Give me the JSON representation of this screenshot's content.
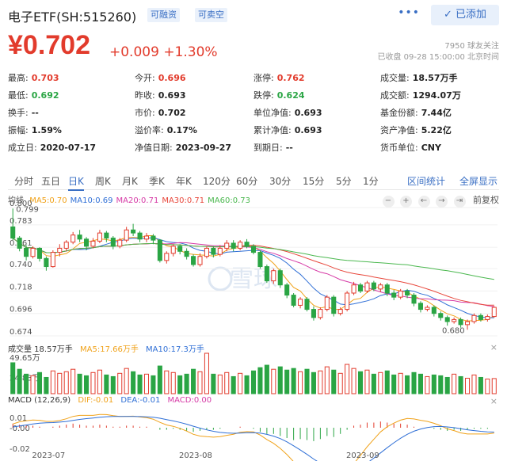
{
  "header": {
    "title": "电子ETF(SH:515260)",
    "tags": [
      "可融资",
      "可卖空"
    ],
    "more": "•••",
    "follow_label": "✓ 已添加"
  },
  "price": {
    "current": "¥0.702",
    "change": "+0.009 +1.30%",
    "followers": "7950 球友关注",
    "status": "已收盘 09-28 15:00:00 北京时间"
  },
  "quote": [
    [
      {
        "label": "最高:",
        "value": "0.703",
        "tone": "up"
      },
      {
        "label": "今开:",
        "value": "0.696",
        "tone": "up"
      },
      {
        "label": "涨停:",
        "value": "0.762",
        "tone": "up"
      },
      {
        "label": "成交量:",
        "value": "18.57万手",
        "tone": ""
      }
    ],
    [
      {
        "label": "最低:",
        "value": "0.692",
        "tone": "down"
      },
      {
        "label": "昨收:",
        "value": "0.693",
        "tone": ""
      },
      {
        "label": "跌停:",
        "value": "0.624",
        "tone": "down"
      },
      {
        "label": "成交额:",
        "value": "1294.07万",
        "tone": ""
      }
    ],
    [
      {
        "label": "换手:",
        "value": "--",
        "tone": ""
      },
      {
        "label": "市价:",
        "value": "0.702",
        "tone": ""
      },
      {
        "label": "单位净值:",
        "value": "0.693",
        "tone": ""
      },
      {
        "label": "基金份额:",
        "value": "7.44亿",
        "tone": ""
      }
    ],
    [
      {
        "label": "振幅:",
        "value": "1.59%",
        "tone": ""
      },
      {
        "label": "溢价率:",
        "value": "0.17%",
        "tone": ""
      },
      {
        "label": "累计净值:",
        "value": "0.693",
        "tone": ""
      },
      {
        "label": "资产净值:",
        "value": "5.22亿",
        "tone": ""
      }
    ],
    [
      {
        "label": "成立日:",
        "value": "2020-07-17",
        "tone": ""
      },
      {
        "label": "净值日期:",
        "value": "2023-09-27",
        "tone": ""
      },
      {
        "label": "到期日:",
        "value": "--",
        "tone": ""
      },
      {
        "label": "货币单位:",
        "value": "CNY",
        "tone": ""
      }
    ]
  ],
  "tabs": {
    "items": [
      "分时",
      "五日",
      "日K",
      "周K",
      "月K",
      "季K",
      "年K",
      "120分",
      "60分",
      "30分",
      "15分",
      "5分",
      "1分"
    ],
    "active": "日K",
    "links": [
      "区间统计",
      "全屏显示"
    ]
  },
  "ma_legend": {
    "label": "均线",
    "items": [
      {
        "text": "MA5:0.70",
        "color": "#f0a21a"
      },
      {
        "text": "MA10:0.69",
        "color": "#2f6fd6"
      },
      {
        "text": "MA20:0.71",
        "color": "#d63aa6"
      },
      {
        "text": "MA30:0.71",
        "color": "#e8483c"
      },
      {
        "text": "MA60:0.73",
        "color": "#4bb84f"
      }
    ]
  },
  "tools": {
    "buttons": [
      "−",
      "+",
      "←",
      "→",
      "⇥"
    ],
    "adjust": "前复权"
  },
  "price_axis": [
    "0.800",
    "0.783",
    "0.761",
    "0.740",
    "0.718",
    "0.696",
    "0.674"
  ],
  "price_labels": {
    "high": "0.799",
    "low": "0.680"
  },
  "volume_legend": {
    "label": "成交量 18.57万手",
    "ma5": "MA5:17.66万手",
    "ma10": "MA10:17.3万手"
  },
  "volume_axis": [
    "49.65万",
    "24.83万"
  ],
  "macd_legend": {
    "label": "MACD (12,26,9)",
    "dif": "DIF:-0.01",
    "dea": "DEA:-0.01",
    "macd": "MACD:0.00"
  },
  "macd_axis": [
    "0.01",
    "-0.00",
    "-0.02"
  ],
  "x_axis": [
    "2023-07",
    "2023-08",
    "2023-09"
  ],
  "watermark": "雪球",
  "colors": {
    "up": "#e23b2c",
    "down": "#2aa544",
    "accent": "#3a6fc4"
  },
  "chart_data": {
    "type": "candlestick",
    "ylim": [
      0.674,
      0.8
    ],
    "candles": [
      [
        0.781,
        0.77,
        0.799,
        0.768
      ],
      [
        0.77,
        0.76,
        0.772,
        0.757
      ],
      [
        0.76,
        0.752,
        0.763,
        0.748
      ],
      [
        0.752,
        0.76,
        0.762,
        0.75
      ],
      [
        0.76,
        0.75,
        0.761,
        0.747
      ],
      [
        0.75,
        0.742,
        0.752,
        0.738
      ],
      [
        0.742,
        0.756,
        0.758,
        0.741
      ],
      [
        0.756,
        0.76,
        0.764,
        0.752
      ],
      [
        0.76,
        0.766,
        0.768,
        0.757
      ],
      [
        0.766,
        0.773,
        0.776,
        0.764
      ],
      [
        0.773,
        0.769,
        0.778,
        0.766
      ],
      [
        0.769,
        0.762,
        0.771,
        0.758
      ],
      [
        0.762,
        0.767,
        0.77,
        0.76
      ],
      [
        0.767,
        0.775,
        0.778,
        0.765
      ],
      [
        0.775,
        0.77,
        0.777,
        0.766
      ],
      [
        0.77,
        0.762,
        0.772,
        0.759
      ],
      [
        0.762,
        0.768,
        0.77,
        0.76
      ],
      [
        0.768,
        0.778,
        0.781,
        0.766
      ],
      [
        0.778,
        0.775,
        0.784,
        0.772
      ],
      [
        0.775,
        0.769,
        0.777,
        0.766
      ],
      [
        0.769,
        0.772,
        0.775,
        0.766
      ],
      [
        0.772,
        0.768,
        0.774,
        0.764
      ],
      [
        0.768,
        0.748,
        0.769,
        0.746
      ],
      [
        0.748,
        0.755,
        0.757,
        0.745
      ],
      [
        0.755,
        0.762,
        0.764,
        0.752
      ],
      [
        0.762,
        0.757,
        0.764,
        0.754
      ],
      [
        0.757,
        0.752,
        0.76,
        0.749
      ],
      [
        0.752,
        0.744,
        0.754,
        0.742
      ],
      [
        0.744,
        0.752,
        0.755,
        0.742
      ],
      [
        0.752,
        0.76,
        0.762,
        0.75
      ],
      [
        0.76,
        0.754,
        0.762,
        0.751
      ],
      [
        0.754,
        0.76,
        0.763,
        0.752
      ],
      [
        0.76,
        0.765,
        0.768,
        0.757
      ],
      [
        0.765,
        0.76,
        0.768,
        0.757
      ],
      [
        0.76,
        0.766,
        0.768,
        0.758
      ],
      [
        0.766,
        0.762,
        0.769,
        0.76
      ],
      [
        0.762,
        0.756,
        0.764,
        0.754
      ],
      [
        0.756,
        0.742,
        0.758,
        0.74
      ],
      [
        0.742,
        0.728,
        0.744,
        0.726
      ],
      [
        0.728,
        0.738,
        0.74,
        0.725
      ],
      [
        0.738,
        0.724,
        0.74,
        0.721
      ],
      [
        0.724,
        0.714,
        0.726,
        0.711
      ],
      [
        0.714,
        0.704,
        0.716,
        0.702
      ],
      [
        0.704,
        0.71,
        0.712,
        0.701
      ],
      [
        0.71,
        0.7,
        0.712,
        0.698
      ],
      [
        0.7,
        0.692,
        0.703,
        0.689
      ],
      [
        0.692,
        0.7,
        0.702,
        0.69
      ],
      [
        0.7,
        0.712,
        0.714,
        0.698
      ],
      [
        0.712,
        0.696,
        0.714,
        0.693
      ],
      [
        0.696,
        0.7,
        0.702,
        0.694
      ],
      [
        0.7,
        0.716,
        0.718,
        0.698
      ],
      [
        0.716,
        0.724,
        0.727,
        0.714
      ],
      [
        0.724,
        0.718,
        0.726,
        0.716
      ],
      [
        0.718,
        0.726,
        0.728,
        0.716
      ],
      [
        0.726,
        0.72,
        0.728,
        0.718
      ],
      [
        0.72,
        0.724,
        0.726,
        0.717
      ],
      [
        0.724,
        0.716,
        0.726,
        0.713
      ],
      [
        0.716,
        0.712,
        0.719,
        0.709
      ],
      [
        0.712,
        0.718,
        0.72,
        0.71
      ],
      [
        0.718,
        0.714,
        0.72,
        0.711
      ],
      [
        0.714,
        0.706,
        0.716,
        0.703
      ],
      [
        0.706,
        0.7,
        0.708,
        0.697
      ],
      [
        0.7,
        0.702,
        0.704,
        0.698
      ],
      [
        0.702,
        0.696,
        0.704,
        0.693
      ],
      [
        0.696,
        0.692,
        0.698,
        0.689
      ],
      [
        0.692,
        0.688,
        0.694,
        0.684
      ],
      [
        0.688,
        0.69,
        0.692,
        0.686
      ],
      [
        0.69,
        0.685,
        0.692,
        0.682
      ],
      [
        0.685,
        0.688,
        0.69,
        0.68
      ],
      [
        0.688,
        0.694,
        0.696,
        0.686
      ],
      [
        0.694,
        0.69,
        0.696,
        0.688
      ],
      [
        0.69,
        0.693,
        0.695,
        0.688
      ],
      [
        0.693,
        0.702,
        0.703,
        0.692
      ]
    ],
    "volume": [
      38,
      30,
      24,
      22,
      26,
      20,
      28,
      25,
      27,
      30,
      24,
      22,
      26,
      29,
      23,
      21,
      25,
      31,
      27,
      23,
      24,
      22,
      34,
      28,
      26,
      22,
      24,
      30,
      27,
      49.65,
      24,
      23,
      26,
      21,
      25,
      22,
      28,
      32,
      35,
      30,
      33,
      29,
      31,
      27,
      30,
      26,
      28,
      33,
      29,
      25,
      36,
      31,
      27,
      29,
      24,
      26,
      28,
      23,
      25,
      22,
      26,
      24,
      21,
      23,
      22,
      20,
      24,
      21,
      19,
      23,
      20,
      18,
      18.57
    ],
    "macd_hist": [
      0.004,
      0.003,
      0.002,
      0.002,
      0.001,
      0.0,
      0.001,
      0.002,
      0.003,
      0.004,
      0.003,
      0.002,
      0.002,
      0.003,
      0.002,
      0.001,
      0.001,
      0.002,
      0.002,
      0.001,
      0.001,
      0.0,
      -0.002,
      -0.002,
      -0.001,
      -0.002,
      -0.003,
      -0.004,
      -0.003,
      -0.002,
      -0.002,
      -0.001,
      0.0,
      0.0,
      0.001,
      0.0,
      -0.001,
      -0.004,
      -0.006,
      -0.006,
      -0.008,
      -0.01,
      -0.012,
      -0.011,
      -0.012,
      -0.013,
      -0.011,
      -0.008,
      -0.009,
      -0.006,
      -0.002,
      0.002,
      0.003,
      0.005,
      0.005,
      0.006,
      0.005,
      0.004,
      0.004,
      0.003,
      0.001,
      0.0,
      0.0,
      -0.001,
      -0.002,
      -0.003,
      -0.002,
      -0.003,
      -0.002,
      -0.001,
      -0.001,
      -0.001,
      0.0
    ]
  }
}
